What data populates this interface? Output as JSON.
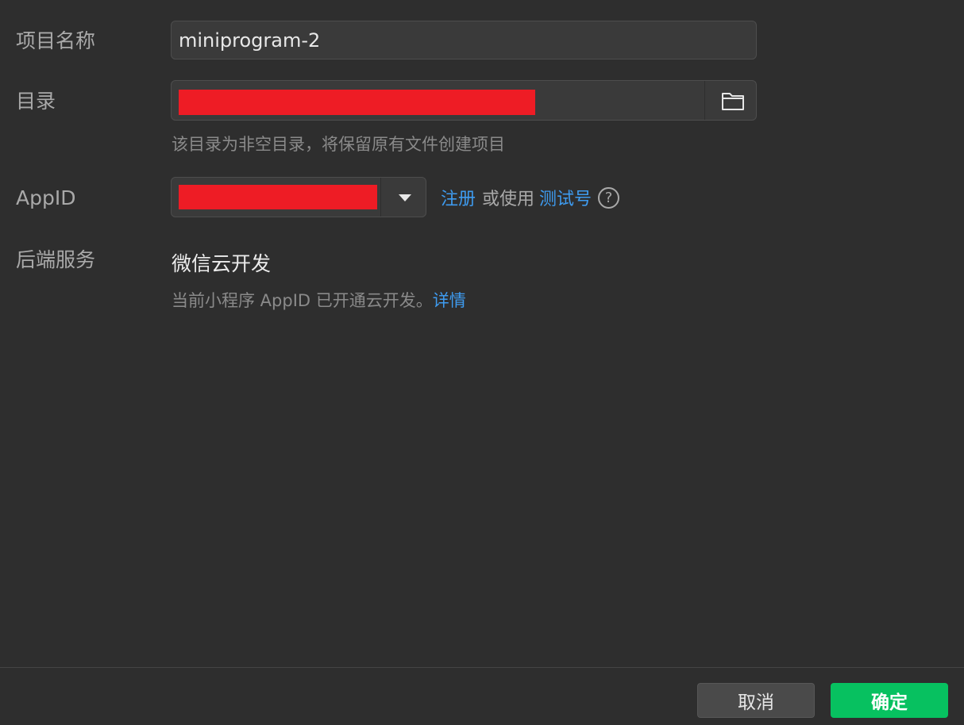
{
  "form": {
    "project_name": {
      "label": "项目名称",
      "value": "miniprogram-2"
    },
    "directory": {
      "label": "目录",
      "value": "",
      "hint": "该目录为非空目录，将保留原有文件创建项目",
      "button_icon": "folder-icon"
    },
    "appid": {
      "label": "AppID",
      "value": "",
      "register_link": "注册",
      "or_use_text": "或使用",
      "test_account_link": "测试号",
      "help_icon": "?"
    },
    "backend": {
      "label": "后端服务",
      "value": "微信云开发",
      "hint": "当前小程序 AppID 已开通云开发。",
      "details_link": "详情"
    }
  },
  "footer": {
    "cancel_label": "取消",
    "confirm_label": "确定"
  },
  "colors": {
    "background": "#2e2e2e",
    "input_bg": "#3a3a3a",
    "link": "#3e9bef",
    "primary": "#07c160",
    "redaction": "#ee1c25"
  }
}
